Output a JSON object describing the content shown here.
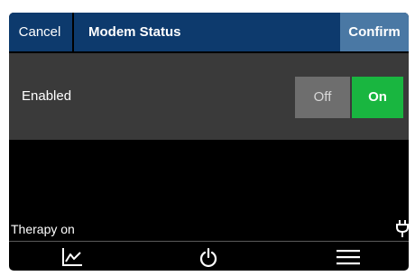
{
  "header": {
    "cancel_label": "Cancel",
    "title": "Modem Status",
    "confirm_label": "Confirm"
  },
  "setting": {
    "label": "Enabled",
    "toggle": {
      "off_label": "Off",
      "on_label": "On",
      "selected": "On"
    }
  },
  "status": {
    "text": "Therapy on",
    "icon": "plug-icon"
  },
  "nav": {
    "items": [
      "chart-icon",
      "power-icon",
      "menu-icon"
    ]
  },
  "colors": {
    "header_bg": "#0d3a6d",
    "confirm_bg": "#4a78a4",
    "row_bg": "#3a3a3a",
    "toggle_off_bg": "#6e6e6e",
    "toggle_on_bg": "#19b640",
    "screen_bg": "#000000"
  }
}
